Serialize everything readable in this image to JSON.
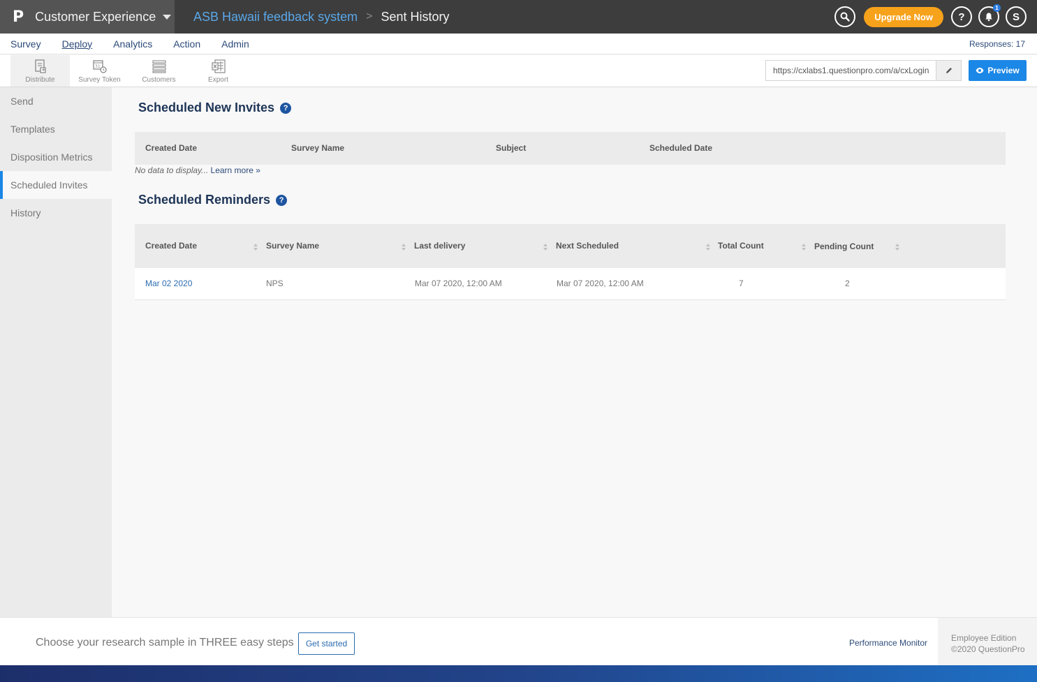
{
  "header": {
    "logo": "P",
    "app_name": "Customer Experience",
    "breadcrumb_survey": "ASB Hawaii feedback system",
    "breadcrumb_separator": ">",
    "breadcrumb_current": "Sent History",
    "upgrade_label": "Upgrade Now",
    "help_label": "?",
    "notification_count": "1",
    "avatar_initial": "S"
  },
  "menu": {
    "items": [
      "Survey",
      "Deploy",
      "Analytics",
      "Action",
      "Admin"
    ],
    "active": "Deploy",
    "responses": "Responses: 17"
  },
  "toolbar": {
    "tools": [
      {
        "label": "Distribute",
        "icon": "distribute-icon"
      },
      {
        "label": "Survey Token",
        "icon": "survey-token-icon"
      },
      {
        "label": "Customers",
        "icon": "customers-icon"
      },
      {
        "label": "Export",
        "icon": "excel-export-icon"
      }
    ],
    "url_value": "https://cxlabs1.questionpro.com/a/cxLogin",
    "preview_label": "Preview"
  },
  "sidebar": {
    "items": [
      "Send",
      "Templates",
      "Disposition Metrics",
      "Scheduled Invites",
      "History"
    ],
    "active": "Scheduled Invites"
  },
  "scheduled_invites": {
    "title": "Scheduled New Invites",
    "columns": [
      "Created Date",
      "Survey Name",
      "Subject",
      "Scheduled Date"
    ],
    "no_data_text": "No data to display...",
    "learn_more": "Learn more »"
  },
  "scheduled_reminders": {
    "title": "Scheduled Reminders",
    "columns": [
      "Created Date",
      "Survey Name",
      "Last delivery",
      "Next Scheduled",
      "Total Count",
      "Pending Count"
    ],
    "rows": [
      {
        "created": "Mar 02 2020",
        "survey": "NPS",
        "last_delivery": "Mar 07 2020, 12:00 AM",
        "next_scheduled": "Mar 07 2020, 12:00 AM",
        "total": "7",
        "pending": "2"
      }
    ]
  },
  "footer": {
    "promo_text": "Choose your research sample in THREE easy steps",
    "get_started": "Get started",
    "performance_monitor": "Performance Monitor",
    "edition": "Employee Edition",
    "copyright": "©2020 QuestionPro"
  },
  "colors": {
    "topbar": "#3d3d3d",
    "accent_blue": "#1b87e6",
    "upgrade_orange": "#f7a21b",
    "heading_navy": "#1e3557"
  }
}
